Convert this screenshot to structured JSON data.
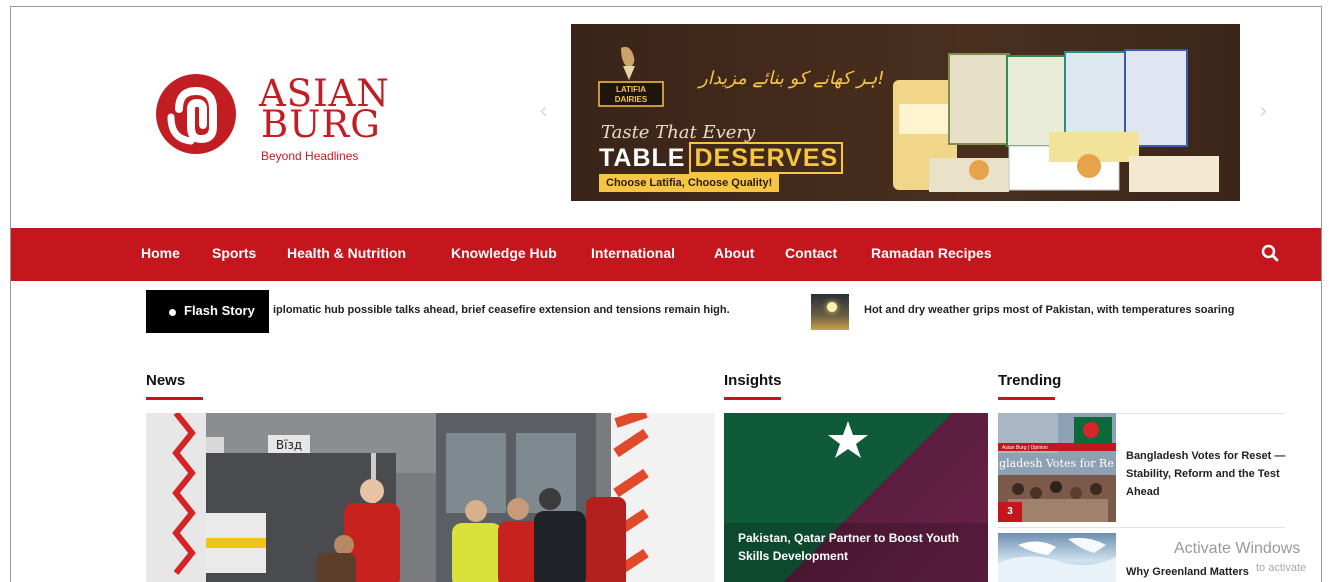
{
  "brand": {
    "logo_line1": "ASIAN",
    "logo_line2": "BURG",
    "tagline": "Beyond Headlines",
    "accent_color": "#c4161c"
  },
  "banner": {
    "brand_name": "LATIFIA DAIRIES",
    "urdu_text": "ہر کھانے کو بنائے مزیدار!",
    "tagline_script": "Taste That Every",
    "tagline_main_1": "TABLE",
    "tagline_main_2": "DESERVES",
    "cta": "Choose Latifia, Choose Quality!",
    "prev_icon": "chevron-left-icon",
    "next_icon": "chevron-right-icon"
  },
  "nav": {
    "items": [
      "Home",
      "Sports",
      "Health & Nutrition",
      "Knowledge Hub",
      "International",
      "About",
      "Contact",
      "Ramadan Recipes"
    ],
    "search_icon": "search-icon"
  },
  "ticker": {
    "label": "Flash Story",
    "item1": "iplomatic hub possible talks ahead, brief ceasefire extension and tensions remain high.",
    "item2": "Hot and dry weather grips most of Pakistan, with temperatures soaring"
  },
  "sections": {
    "news": "News",
    "insights": "Insights",
    "trending": "Trending"
  },
  "news": {
    "sign_text": "Вїзд"
  },
  "insights": {
    "caption": "Pakistan, Qatar Partner to Boost Youth Skills Development"
  },
  "trending": {
    "item1_title": "Bangladesh Votes for Reset — Stability, Reform and the Test Ahead",
    "item1_thumb_text": "ngladesh Votes for Re",
    "item1_thumb_tag": "Asian Burg | Opinion",
    "item1_badge": "3",
    "item2_title": "Why Greenland Matters"
  },
  "watermark": {
    "line1": "Activate Windows",
    "line2": "to activate"
  }
}
